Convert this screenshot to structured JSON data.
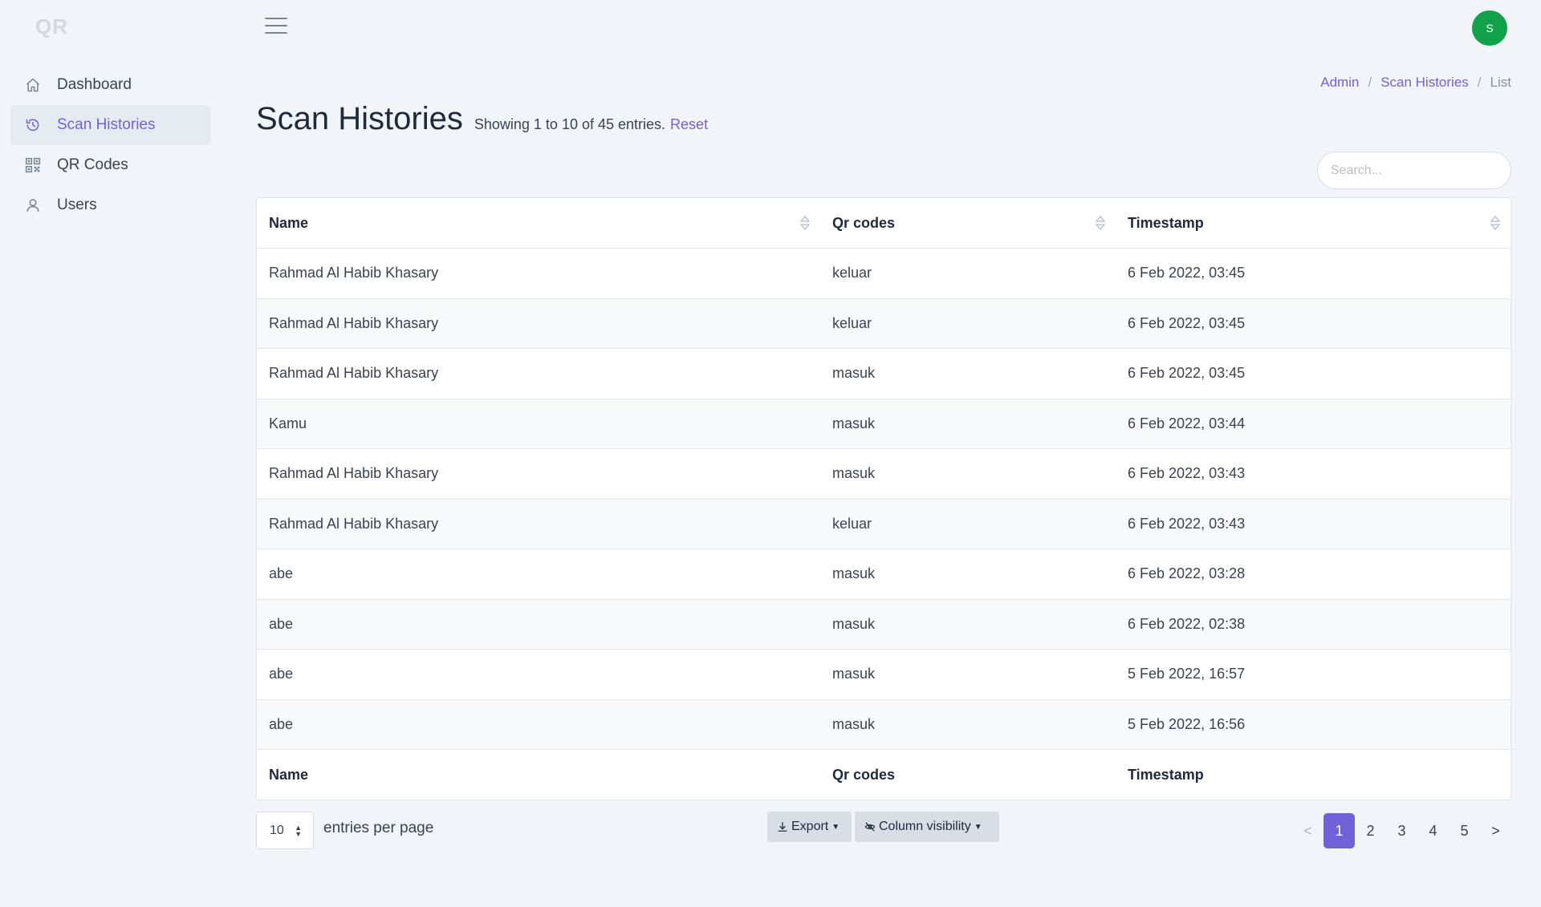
{
  "app": {
    "logo": "QR"
  },
  "sidebar": {
    "items": [
      {
        "label": "Dashboard",
        "icon": "home-icon"
      },
      {
        "label": "Scan Histories",
        "icon": "history-icon",
        "active": true
      },
      {
        "label": "QR Codes",
        "icon": "qr-code-icon"
      },
      {
        "label": "Users",
        "icon": "user-icon"
      }
    ]
  },
  "header": {
    "avatar_initial": "S",
    "avatar_color": "#12a14b"
  },
  "breadcrumb": {
    "items": [
      "Admin",
      "Scan Histories",
      "List"
    ],
    "separator": "/"
  },
  "page": {
    "title": "Scan Histories",
    "entries_info": "Showing 1 to 10 of 45 entries.",
    "reset_label": "Reset",
    "search_placeholder": "Search..."
  },
  "table": {
    "columns": [
      "Name",
      "Qr codes",
      "Timestamp"
    ],
    "rows": [
      [
        "Rahmad Al Habib Khasary",
        "keluar",
        "6 Feb 2022, 03:45"
      ],
      [
        "Rahmad Al Habib Khasary",
        "keluar",
        "6 Feb 2022, 03:45"
      ],
      [
        "Rahmad Al Habib Khasary",
        "masuk",
        "6 Feb 2022, 03:45"
      ],
      [
        "Kamu",
        "masuk",
        "6 Feb 2022, 03:44"
      ],
      [
        "Rahmad Al Habib Khasary",
        "masuk",
        "6 Feb 2022, 03:43"
      ],
      [
        "Rahmad Al Habib Khasary",
        "keluar",
        "6 Feb 2022, 03:43"
      ],
      [
        "abe",
        "masuk",
        "6 Feb 2022, 03:28"
      ],
      [
        "abe",
        "masuk",
        "6 Feb 2022, 02:38"
      ],
      [
        "abe",
        "masuk",
        "5 Feb 2022, 16:57"
      ],
      [
        "abe",
        "masuk",
        "5 Feb 2022, 16:56"
      ]
    ]
  },
  "footer": {
    "per_page_value": "10",
    "per_page_label": "entries per page",
    "export_label": "Export",
    "column_visibility_label": "Column visibility",
    "pagination": {
      "prev": "<",
      "next": ">",
      "pages": [
        "1",
        "2",
        "3",
        "4",
        "5"
      ],
      "current": "1"
    }
  },
  "colors": {
    "accent": "#7262d7",
    "background": "#f1f4f8"
  }
}
